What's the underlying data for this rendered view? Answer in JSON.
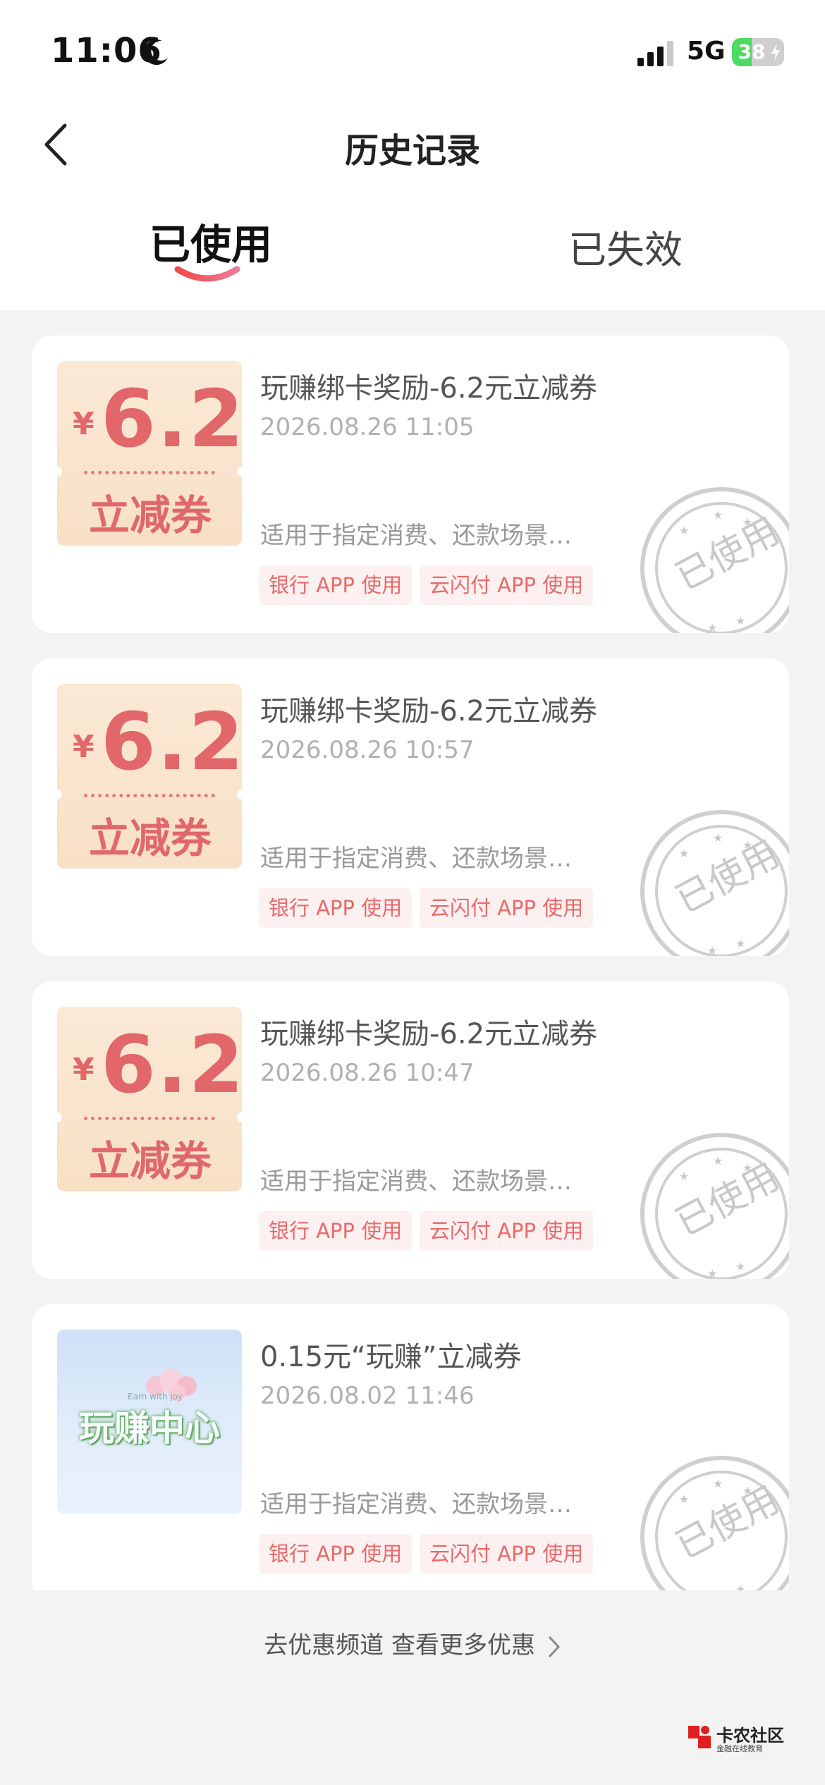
{
  "status_bar": {
    "time": "11:06",
    "network": "5G",
    "battery": "38",
    "battery_level": 0.38
  },
  "nav": {
    "title": "历史记录"
  },
  "tabs": [
    {
      "label": "已使用",
      "active": true
    },
    {
      "label": "已失效",
      "active": false
    }
  ],
  "coupons": [
    {
      "thumb_yen": "¥",
      "thumb_amount": "6.2",
      "thumb_sub": "立减券",
      "title": "玩赚绑卡奖励-6.2元立减券",
      "date": "2026.08.26 11:05",
      "desc": "适用于指定消费、还款场景…",
      "tags": [
        "银行 APP 使用",
        "云闪付 APP 使用"
      ],
      "stamp": "已使用"
    },
    {
      "thumb_yen": "¥",
      "thumb_amount": "6.2",
      "thumb_sub": "立减券",
      "title": "玩赚绑卡奖励-6.2元立减券",
      "date": "2026.08.26 10:57",
      "desc": "适用于指定消费、还款场景…",
      "tags": [
        "银行 APP 使用",
        "云闪付 APP 使用"
      ],
      "stamp": "已使用"
    },
    {
      "thumb_yen": "¥",
      "thumb_amount": "6.2",
      "thumb_sub": "立减券",
      "title": "玩赚绑卡奖励-6.2元立减券",
      "date": "2026.08.26 10:47",
      "desc": "适用于指定消费、还款场景…",
      "tags": [
        "银行 APP 使用",
        "云闪付 APP 使用"
      ],
      "stamp": "已使用"
    },
    {
      "thumb_promo_text": "玩赚中心",
      "thumb_promo_sub": "Earn with joy",
      "title": "0.15元“玩赚”立减券",
      "date": "2026.08.02 11:46",
      "desc": "适用于指定消费、还款场景…",
      "tags": [
        "银行 APP 使用",
        "云闪付 APP 使用"
      ],
      "stamp": "已使用"
    }
  ],
  "footer": {
    "link": "去优惠频道 查看更多优惠"
  },
  "watermark": {
    "name": "卡农社区",
    "sub": "金融在线教育"
  },
  "colors": {
    "accent": "#e86a6a",
    "stamp": "#cccccc",
    "coupon_bg": "#fbe9d6"
  }
}
